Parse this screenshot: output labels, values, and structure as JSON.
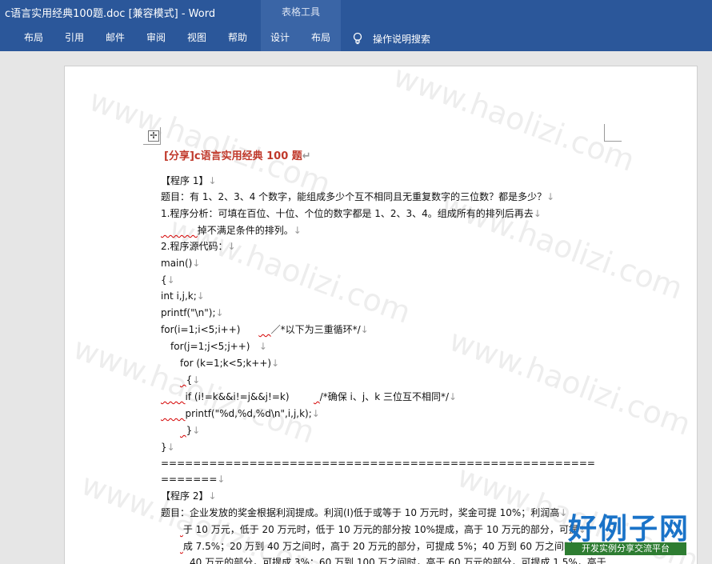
{
  "window": {
    "title": "c语言实用经典100题.doc [兼容模式]  -  Word",
    "context_group": "表格工具"
  },
  "ribbon": {
    "tabs": [
      "布局",
      "引用",
      "邮件",
      "审阅",
      "视图",
      "帮助",
      "设计",
      "布局"
    ],
    "tell_me": "操作说明搜索"
  },
  "document": {
    "heading": "[分享]c语言实用经典 100 题",
    "lines": [
      "【程序 1】",
      "题目：有 1、2、3、4 个数字，能组成多少个互不相同且无重复数字的三位数？都是多少？",
      "1.程序分析：可填在百位、十位、个位的数字都是 1、2、3、4。组成所有的排列后再去",
      "掉不满足条件的排列。",
      "2.程序源代码：",
      "main()",
      "{",
      "int i,j,k;",
      "printf(\"\\n\");",
      "for(i=1;i<5;i++)",
      "／*以下为三重循环*/",
      "for(j=1;j<5;j++)",
      "for (k=1;k<5;k++)",
      "{",
      "if (i!=k&&i!=j&&j!=k)",
      "/*确保 i、j、k 三位互不相同*/",
      "printf(\"%d,%d,%d\\n\",i,j,k);",
      "}",
      "}",
      "======================================================",
      "=======",
      "【程序 2】",
      "题目：企业发放的奖金根据利润提成。利润(I)低于或等于 10 万元时，奖金可提 10%；利润高",
      "于 10 万元，低于 20 万元时，低于 10 万元的部分按 10%提成，高于 10 万元的部分，可提",
      "成 7.5%；20 万到 40 万之间时，高于 20 万元的部分，可提成 5%；40 万到 60 万之间时",
      "40 万元的部分，可提成 3%；60 万到 100 万之间时，高于 60 万元的部分，可提成 1.5%，高于"
    ]
  },
  "watermark": "www.haolizi.com",
  "logo": {
    "title": "好例子网",
    "subtitle": "开发实例分享交流平台"
  }
}
